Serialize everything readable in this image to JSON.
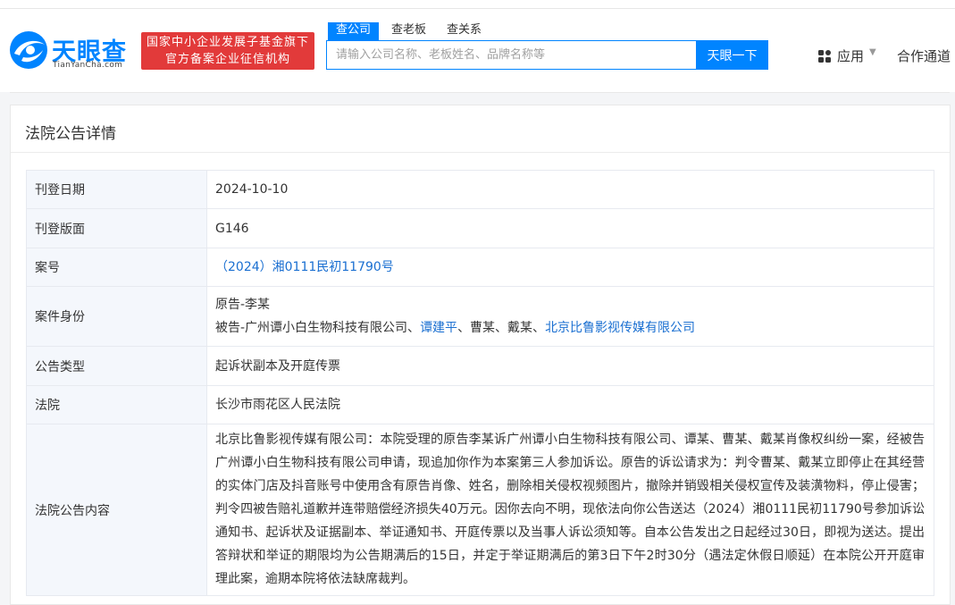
{
  "header": {
    "logo_text": "天眼查",
    "logo_sub": "TianYanCha.com",
    "badge_line1": "国家中小企业发展子基金旗下",
    "badge_line2": "官方备案企业征信机构",
    "tabs": [
      {
        "label": "查公司"
      },
      {
        "label": "查老板"
      },
      {
        "label": "查关系"
      }
    ],
    "search_placeholder": "请输入公司名称、老板姓名、品牌名称等",
    "search_button": "天眼一下",
    "apps_label": "应用",
    "partner_label": "合作通道"
  },
  "card": {
    "title": "法院公告详情",
    "rows": {
      "publish_date": {
        "key": "刊登日期",
        "value": "2024-10-10"
      },
      "publish_page": {
        "key": "刊登版面",
        "value": "G146"
      },
      "case_no": {
        "key": "案号",
        "value": "（2024）湘0111民初11790号"
      },
      "identity": {
        "key": "案件身份",
        "plaintiff": "原告-李某",
        "defendant_prefix": "被告-广州谭小白生物科技有限公司、",
        "defendant_link1": "谭建平",
        "defendant_mid": "、曹某、戴某、",
        "defendant_link2": "北京比鲁影视传媒有限公司"
      },
      "notice_type": {
        "key": "公告类型",
        "value": "起诉状副本及开庭传票"
      },
      "court": {
        "key": "法院",
        "value": "长沙市雨花区人民法院"
      },
      "content": {
        "key": "法院公告内容",
        "value": "北京比鲁影视传媒有限公司：本院受理的原告李某诉广州谭小白生物科技有限公司、谭某、曹某、戴某肖像权纠纷一案，经被告广州谭小白生物科技有限公司申请，现追加你作为本案第三人参加诉讼。原告的诉讼请求为：判令曹某、戴某立即停止在其经营的实体门店及抖音账号中使用含有原告肖像、姓名，删除相关侵权视频图片，撤除并销毁相关侵权宣传及装潢物料，停止侵害；判令四被告赔礼道歉并连带赔偿经济损失40万元。因你去向不明，现依法向你公告送达（2024）湘0111民初11790号参加诉讼通知书、起诉状及证据副本、举证通知书、开庭传票以及当事人诉讼须知等。自本公告发出之日起经过30日，即视为送达。提出答辩状和举证的期限均为公告期满后的15日，并定于举证期满后的第3日下午2时30分（遇法定休假日顺延）在本院公开开庭审理此案，逾期本院将依法缺席裁判。"
      }
    }
  },
  "colors": {
    "brand_blue": "#0084ff",
    "badge_red": "#e23a3a",
    "link_blue": "#1a6fd1"
  }
}
